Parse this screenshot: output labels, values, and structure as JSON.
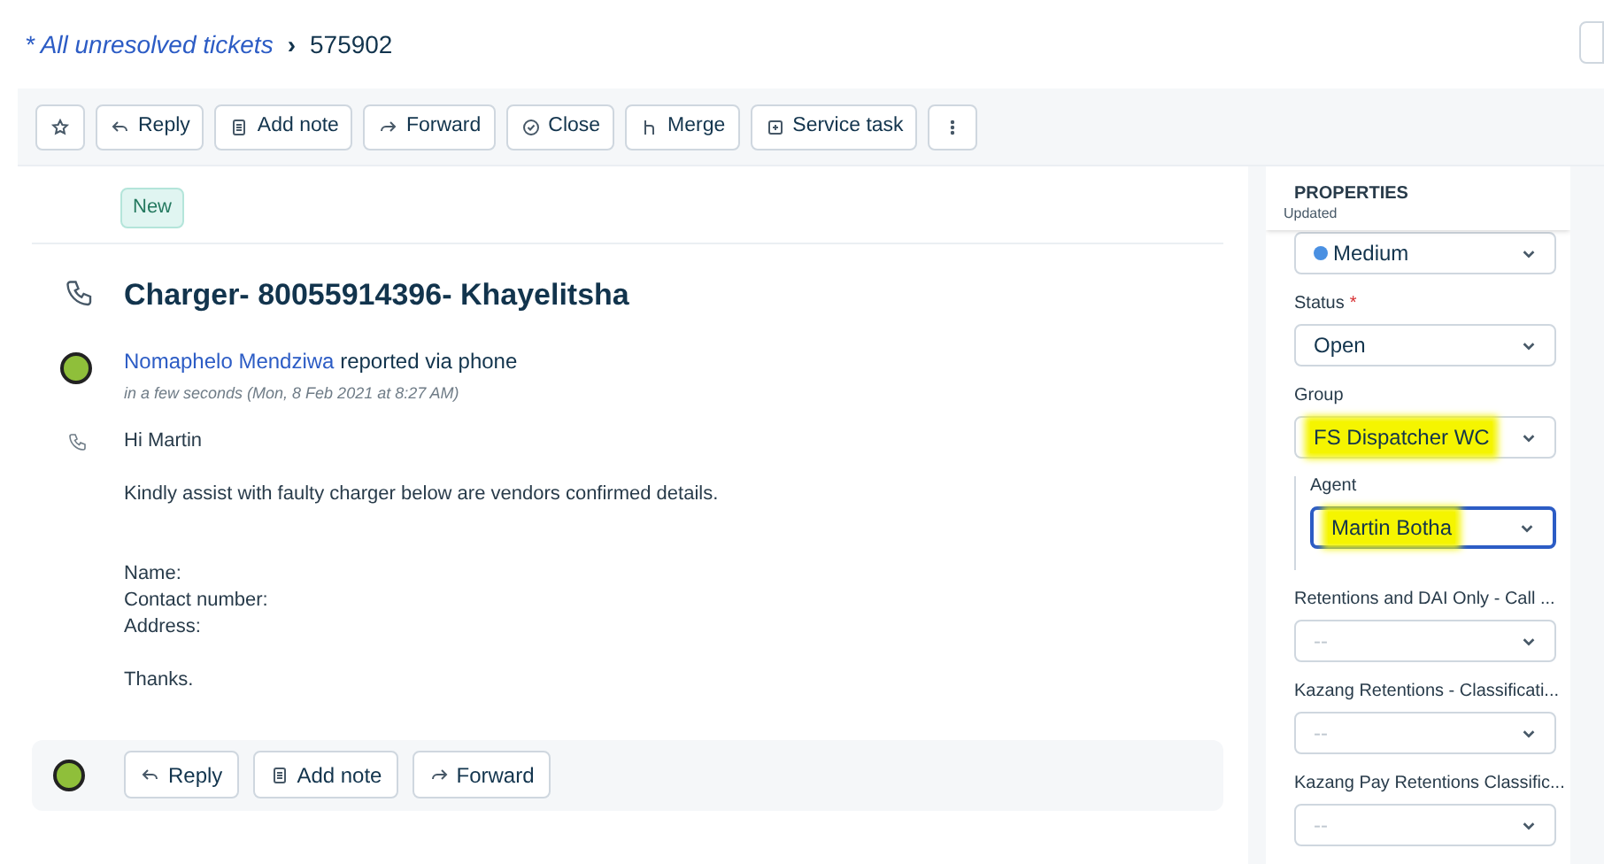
{
  "breadcrumb": {
    "link": "* All unresolved tickets",
    "separator": "›",
    "current": "575902"
  },
  "toolbar": [
    {
      "kind": "star"
    },
    {
      "kind": "reply",
      "label": "Reply"
    },
    {
      "kind": "note",
      "label": "Add note"
    },
    {
      "kind": "forward",
      "label": "Forward"
    },
    {
      "kind": "close",
      "label": "Close"
    },
    {
      "kind": "merge",
      "label": "Merge"
    },
    {
      "kind": "task",
      "label": "Service task"
    },
    {
      "kind": "more"
    }
  ],
  "ticket": {
    "badge": "New",
    "subject": "Charger- 80055914396- Khayelitsha",
    "requester": "Nomaphelo Mendziwa",
    "via": "reported via phone",
    "time": "in a few seconds (Mon, 8 Feb 2021 at 8:27 AM)",
    "body": [
      [
        "Hi Martin"
      ],
      [
        "Kindly assist with faulty charger below are vendors confirmed details."
      ],
      [
        "Name:",
        "Contact number:",
        "Address:"
      ],
      [
        "Thanks."
      ]
    ]
  },
  "reply_bar": [
    {
      "kind": "reply",
      "label": "Reply"
    },
    {
      "kind": "note",
      "label": "Add note"
    },
    {
      "kind": "forward",
      "label": "Forward"
    }
  ],
  "properties": {
    "title": "PROPERTIES",
    "status_note": "Updated",
    "fields": [
      {
        "value": "Medium",
        "color": "#4a90e2",
        "highlighted": false,
        "focused": false,
        "nested": false
      },
      {
        "label": "Status",
        "required_mark": "*",
        "value": "Open",
        "highlighted": false,
        "focused": false,
        "nested": false
      },
      {
        "label": "Group",
        "value": "FS Dispatcher WC",
        "highlighted": true,
        "focused": false,
        "nested": false
      },
      {
        "label": "Agent",
        "value": "Martin Botha",
        "highlighted": true,
        "focused": true,
        "nested": true
      },
      {
        "label": "Retentions and DAI Only - Call ...",
        "placeholder": "--",
        "highlighted": false,
        "focused": false,
        "nested": false
      },
      {
        "label": "Kazang Retentions - Classificati...",
        "placeholder": "--",
        "highlighted": false,
        "focused": false,
        "nested": false
      },
      {
        "label": "Kazang Pay Retentions Classific...",
        "placeholder": "--",
        "highlighted": false,
        "focused": false,
        "nested": false
      }
    ]
  }
}
